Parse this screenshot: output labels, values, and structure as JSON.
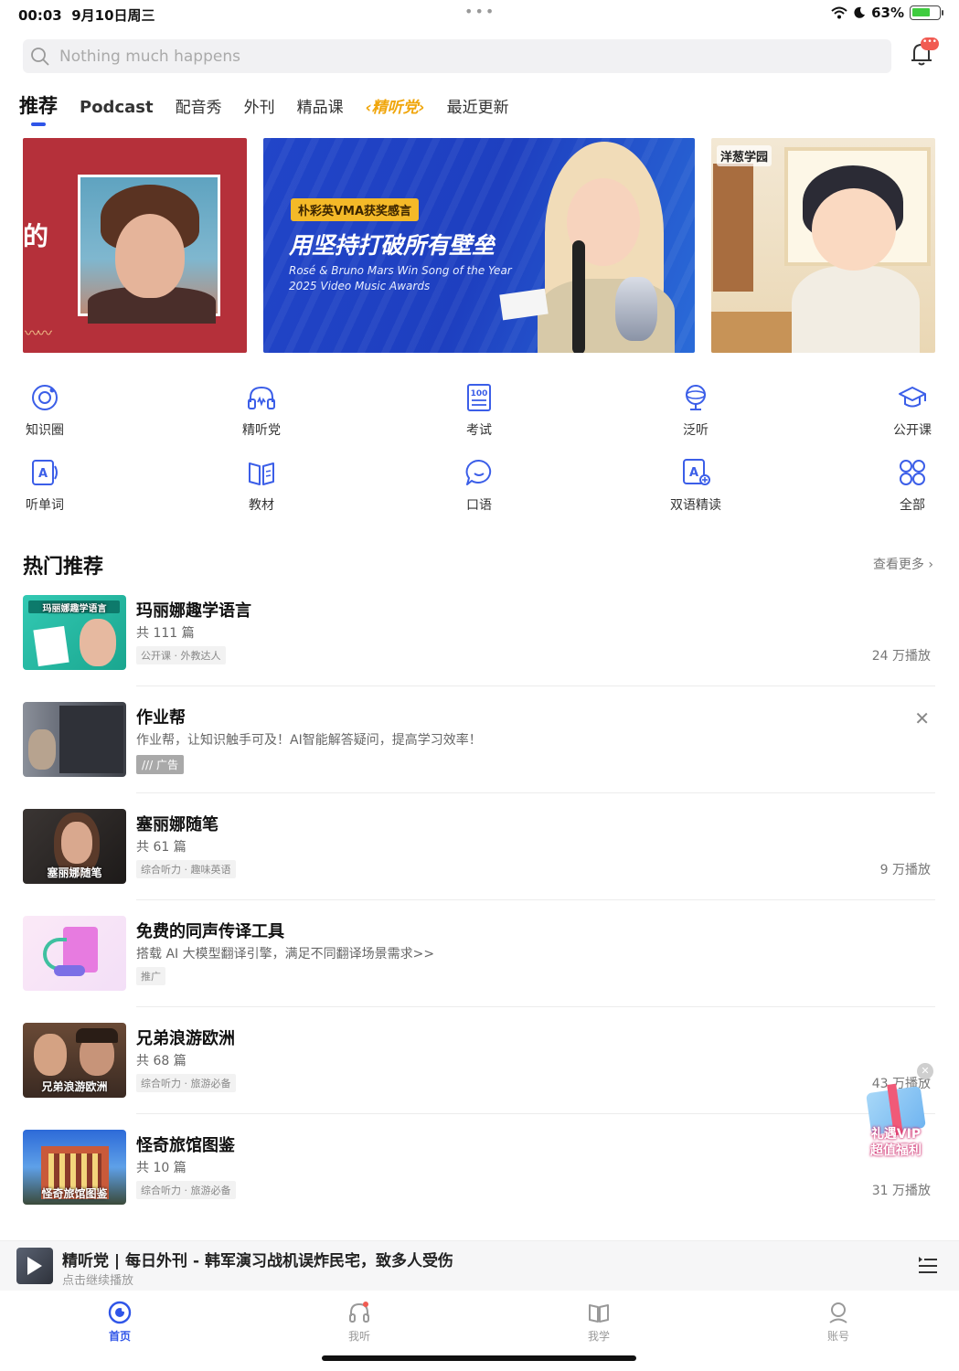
{
  "status_bar": {
    "time": "00:03",
    "date": "9月10日周三",
    "battery": "63%"
  },
  "search": {
    "placeholder": "Nothing much happens"
  },
  "notifications": {
    "badge": "•••"
  },
  "tabs": [
    {
      "label": "推荐",
      "active": true
    },
    {
      "label": "Podcast"
    },
    {
      "label": "配音秀"
    },
    {
      "label": "外刊"
    },
    {
      "label": "精品课"
    },
    {
      "label": "‹精听党›"
    },
    {
      "label": "最近更新"
    }
  ],
  "banners": {
    "first": {
      "text": "的"
    },
    "second": {
      "tag": "朴彩英VMA获奖感言",
      "headline": "用坚持打破所有壁垒",
      "subtitle": "Rosé & Bruno Mars Win Song of the Year 2025 Video Music Awards"
    },
    "third": {
      "logo": "洋葱学园"
    }
  },
  "grid": [
    {
      "label": "知识圈",
      "icon": "circle-refresh-icon"
    },
    {
      "label": "精听党",
      "icon": "headphones-icon"
    },
    {
      "label": "考试",
      "icon": "exam-100-icon"
    },
    {
      "label": "泛听",
      "icon": "globe-icon"
    },
    {
      "label": "公开课",
      "icon": "graduation-cap-icon"
    },
    {
      "label": "听单词",
      "icon": "word-card-icon"
    },
    {
      "label": "教材",
      "icon": "book-icon"
    },
    {
      "label": "口语",
      "icon": "chat-bubble-icon"
    },
    {
      "label": "双语精读",
      "icon": "bilingual-read-icon"
    },
    {
      "label": "全部",
      "icon": "grid-all-icon"
    }
  ],
  "hot": {
    "title": "热门推荐",
    "more": "查看更多",
    "items": [
      {
        "title": "玛丽娜趣学语言",
        "sub": "共 111 篇",
        "chip": "公开课 · 外教达人",
        "plays": "24 万播放",
        "thumb_text": "玛丽娜趣学语言"
      },
      {
        "title": "作业帮",
        "sub": "作业帮，让知识触手可及！AI智能解答疑问，提高学习效率！",
        "chip": "广告"
      },
      {
        "title": "塞丽娜随笔",
        "sub": "共 61 篇",
        "chip": "综合听力 · 趣味英语",
        "plays": "9 万播放",
        "thumb_text": "塞丽娜随笔"
      },
      {
        "title": "免费的同声传译工具",
        "sub": "搭载 AI 大模型翻译引擎，满足不同翻译场景需求>>",
        "chip": "推广"
      },
      {
        "title": "兄弟浪游欧洲",
        "sub": "共 68 篇",
        "chip": "综合听力 · 旅游必备",
        "plays": "43 万播放",
        "thumb_text": "兄弟浪游欧洲"
      },
      {
        "title": "怪奇旅馆图鉴",
        "sub": "共 10 篇",
        "chip": "综合听力 · 旅游必备",
        "plays": "31 万播放",
        "thumb_text": "怪奇旅馆图鉴"
      }
    ]
  },
  "vip_float": {
    "line1": "礼遇VIP",
    "line2": "超值福利"
  },
  "player": {
    "title": "精听党 | 每日外刊 - 韩军演习战机误炸民宅，致多人受伤",
    "sub": "点击继续播放"
  },
  "bottom_nav": [
    {
      "label": "首页",
      "active": true
    },
    {
      "label": "我听"
    },
    {
      "label": "我学"
    },
    {
      "label": "账号"
    }
  ],
  "colors": {
    "accent": "#2f55e8",
    "banner_red": "#b5303a",
    "special_tab": "#f0a60c"
  }
}
